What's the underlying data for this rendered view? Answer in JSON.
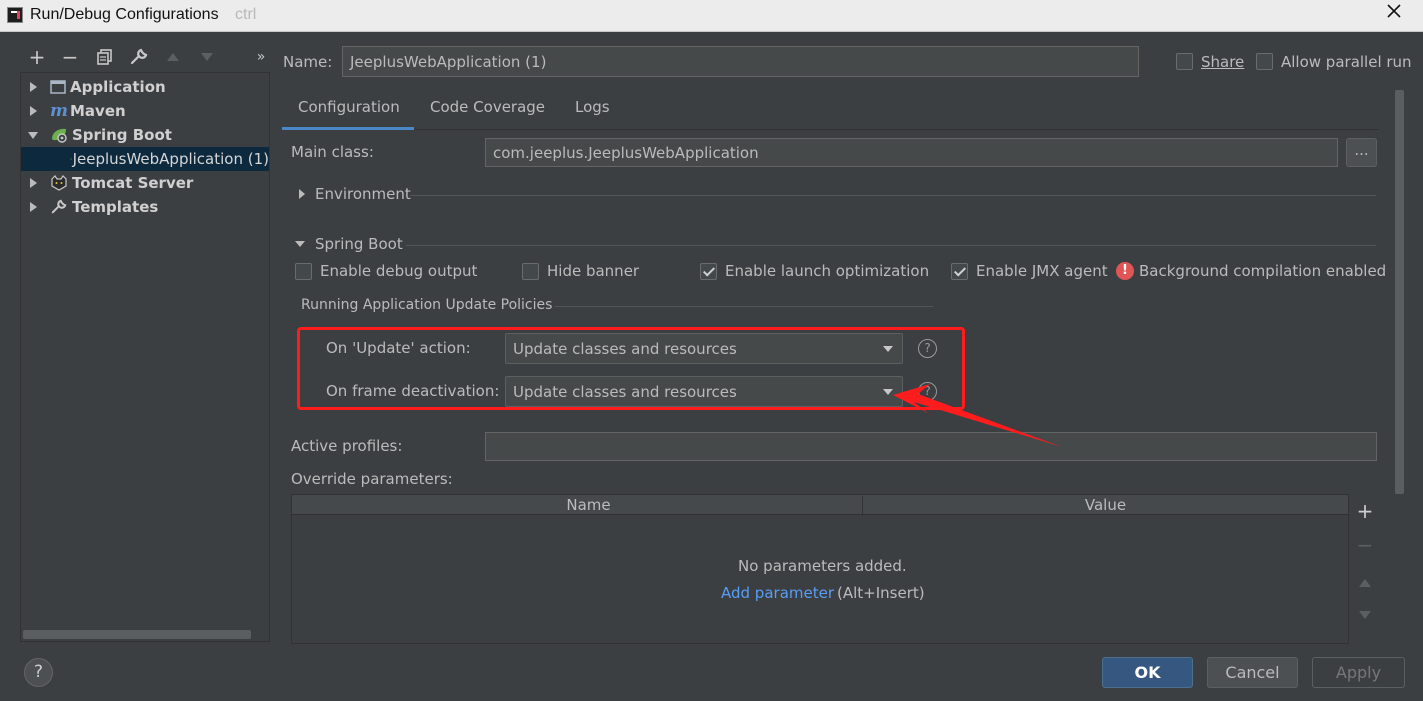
{
  "window": {
    "title": "Run/Debug Configurations",
    "ghost_text": "ctrl",
    "app_icon": "intellij-icon",
    "close_icon": "close-icon"
  },
  "toolbar": {
    "add": "+",
    "remove": "−",
    "more": "»"
  },
  "tree": {
    "items": [
      {
        "label": "Application",
        "icon": "application-icon"
      },
      {
        "label": "Maven",
        "icon": "maven-icon"
      },
      {
        "label": "Spring Boot",
        "icon": "spring-boot-icon"
      },
      {
        "label": "JeeplusWebApplication (1)",
        "icon": "spring-boot-icon"
      },
      {
        "label": "Tomcat Server",
        "icon": "tomcat-icon"
      },
      {
        "label": "Templates",
        "icon": "wrench-icon"
      }
    ]
  },
  "header": {
    "name_label": "Name:",
    "name_value": "JeeplusWebApplication (1)",
    "share_label": "Share",
    "allow_parallel_label": "Allow parallel run"
  },
  "tabs": [
    "Configuration",
    "Code Coverage",
    "Logs"
  ],
  "config": {
    "main_class_label": "Main class:",
    "main_class_value": "com.jeeplus.JeeplusWebApplication",
    "browse_label": "...",
    "environment_label": "Environment",
    "spring_boot_label": "Spring Boot",
    "enable_debug_label": "Enable debug output",
    "enable_debug_checked": false,
    "hide_banner_label": "Hide banner",
    "hide_banner_checked": false,
    "launch_opt_label": "Enable launch optimization",
    "launch_opt_checked": true,
    "jmx_label": "Enable JMX agent",
    "jmx_checked": true,
    "bg_compile_label": "Background compilation enabled",
    "policies_label": "Running Application Update Policies",
    "on_update_label": "On 'Update' action:",
    "on_update_value": "Update classes and resources",
    "on_frame_label": "On frame deactivation:",
    "on_frame_value": "Update classes and resources",
    "help_glyph": "?",
    "active_profiles_label": "Active profiles:",
    "override_params_label": "Override parameters:",
    "table": {
      "columns": [
        "Name",
        "Value"
      ],
      "empty_text": "No parameters added.",
      "add_link": "Add parameter",
      "add_shortcut": "(Alt+Insert)"
    }
  },
  "buttons": {
    "ok": "OK",
    "cancel": "Cancel",
    "apply": "Apply",
    "help": "?"
  },
  "colors": {
    "accent": "#4a88c7",
    "annotation": "#ff1c1c",
    "link": "#589df6",
    "warning": "#e05555"
  }
}
